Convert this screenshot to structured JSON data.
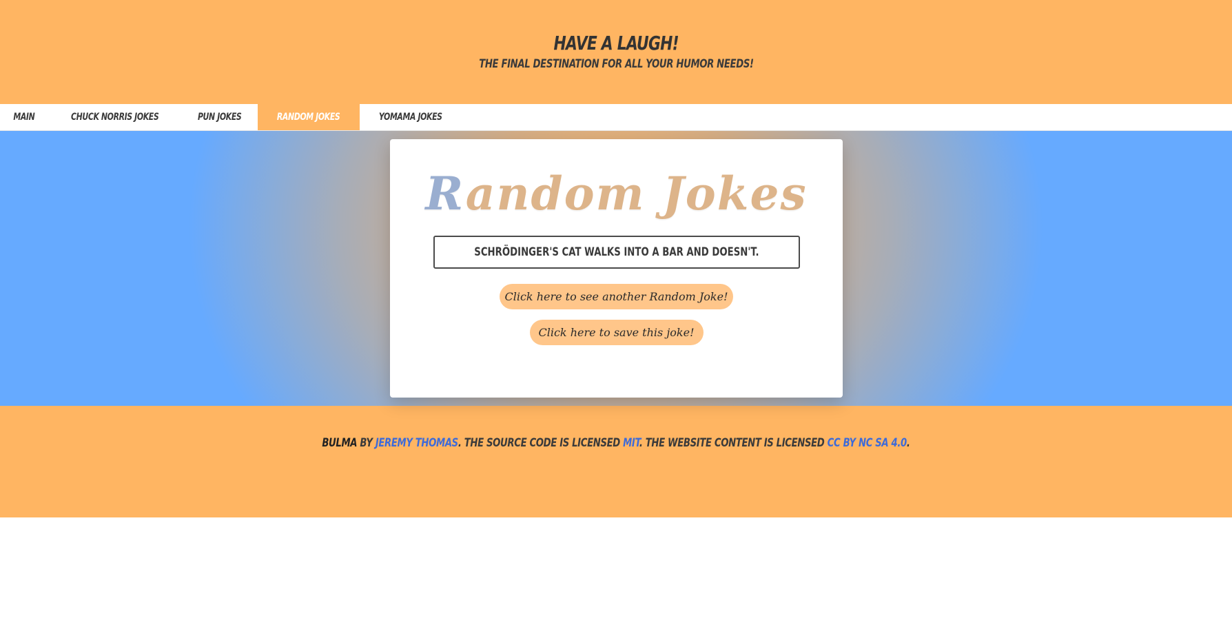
{
  "hero": {
    "title": "Have a laugh!",
    "subtitle": "The final destination for all your humor needs!"
  },
  "tabs": [
    {
      "label": "Main",
      "active": false
    },
    {
      "label": "Chuck Norris Jokes",
      "active": false
    },
    {
      "label": "Pun Jokes",
      "active": false
    },
    {
      "label": "Random Jokes",
      "active": true
    },
    {
      "label": "Yomama Jokes",
      "active": false
    }
  ],
  "card": {
    "title_first_letter": "R",
    "title_rest": "andom Jokes",
    "joke": "Schrödinger's cat walks into a bar and doesn't.",
    "another_button": "Click here to see another Random Joke!",
    "save_button": "Click here to save this joke!"
  },
  "footer": {
    "brand": "Bulma",
    "by": " by ",
    "author": "Jeremy Thomas",
    "text1": ". The source code is licensed ",
    "license": "MIT",
    "text2": ". The website content is licensed ",
    "content_license": "CC BY NC SA 4.0",
    "text3": "."
  },
  "colors": {
    "accent": "#ffb562",
    "button": "#ffc68a",
    "link": "#3e6bd8",
    "gradient_edge": "#66aaff"
  }
}
